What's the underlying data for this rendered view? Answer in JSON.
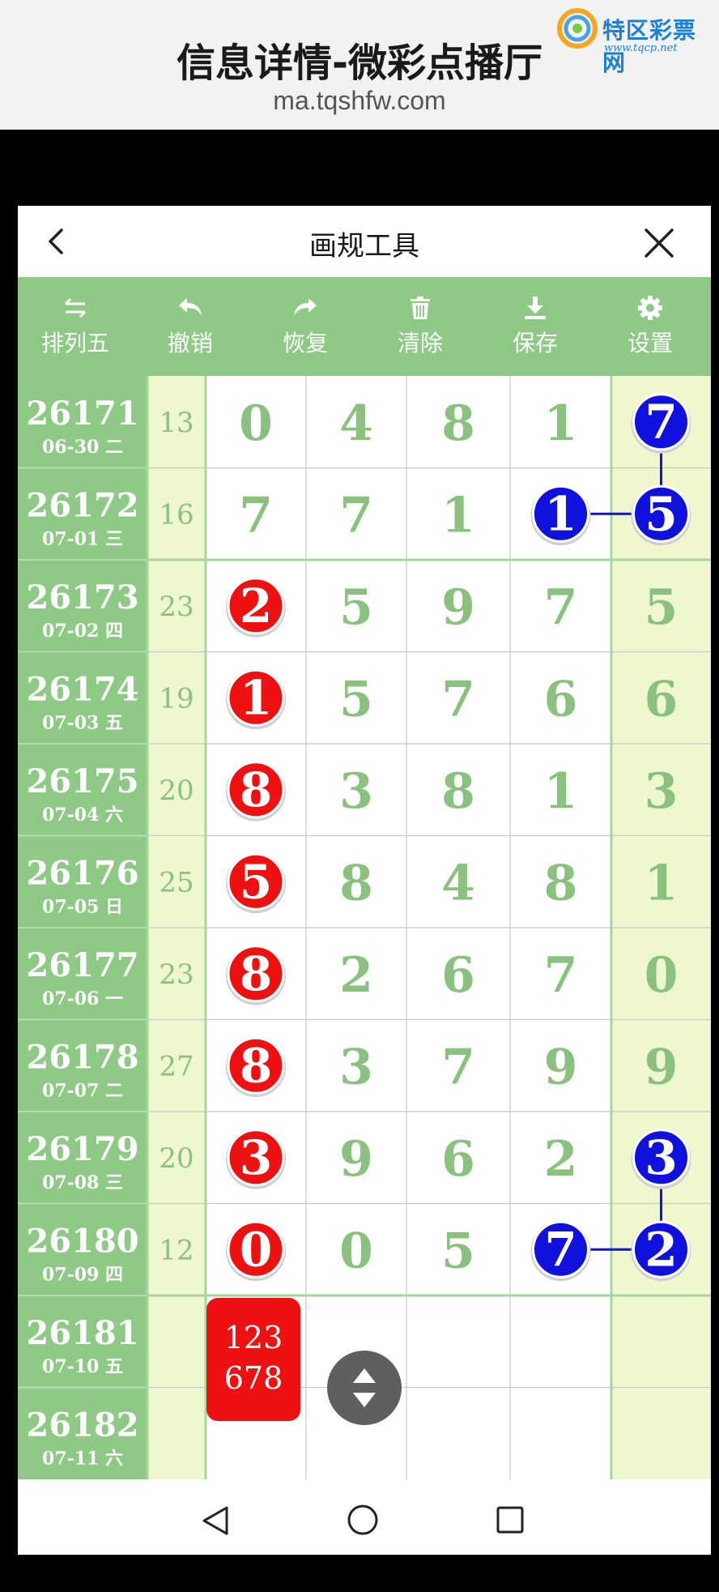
{
  "banner": {
    "title": "信息详情-微彩点播厅",
    "url": "ma.tqshfw.com",
    "logo_name": "特区彩票网",
    "logo_url": "www.tqcp.net"
  },
  "header": {
    "title": "画规工具"
  },
  "toolbar": [
    {
      "label": "排列五",
      "icon": "swap-icon"
    },
    {
      "label": "撤销",
      "icon": "undo-icon"
    },
    {
      "label": "恢复",
      "icon": "redo-icon"
    },
    {
      "label": "清除",
      "icon": "trash-icon"
    },
    {
      "label": "保存",
      "icon": "download-icon"
    },
    {
      "label": "设置",
      "icon": "gear-icon"
    }
  ],
  "rows": [
    {
      "issue": "26171",
      "date": "06-30 二",
      "sum": "13",
      "digits": [
        "0",
        "4",
        "8",
        "1",
        "7"
      ]
    },
    {
      "issue": "26172",
      "date": "07-01 三",
      "sum": "16",
      "digits": [
        "7",
        "7",
        "1",
        "1",
        "5"
      ]
    },
    {
      "issue": "26173",
      "date": "07-02 四",
      "sum": "23",
      "digits": [
        "2",
        "5",
        "9",
        "7",
        "5"
      ]
    },
    {
      "issue": "26174",
      "date": "07-03 五",
      "sum": "19",
      "digits": [
        "1",
        "5",
        "7",
        "6",
        "6"
      ]
    },
    {
      "issue": "26175",
      "date": "07-04 六",
      "sum": "20",
      "digits": [
        "8",
        "3",
        "8",
        "1",
        "3"
      ]
    },
    {
      "issue": "26176",
      "date": "07-05 日",
      "sum": "25",
      "digits": [
        "5",
        "8",
        "4",
        "8",
        "1"
      ]
    },
    {
      "issue": "26177",
      "date": "07-06 一",
      "sum": "23",
      "digits": [
        "8",
        "2",
        "6",
        "7",
        "0"
      ]
    },
    {
      "issue": "26178",
      "date": "07-07 二",
      "sum": "27",
      "digits": [
        "8",
        "3",
        "7",
        "9",
        "9"
      ]
    },
    {
      "issue": "26179",
      "date": "07-08 三",
      "sum": "20",
      "digits": [
        "3",
        "9",
        "6",
        "2",
        "3"
      ]
    },
    {
      "issue": "26180",
      "date": "07-09 四",
      "sum": "12",
      "digits": [
        "0",
        "0",
        "5",
        "7",
        "2"
      ]
    },
    {
      "issue": "26181",
      "date": "07-10 五",
      "sum": "",
      "digits": [
        "",
        "",
        "",
        "",
        ""
      ]
    },
    {
      "issue": "26182",
      "date": "07-11 六",
      "sum": "",
      "digits": [
        "",
        "",
        "",
        "",
        ""
      ]
    }
  ],
  "red_marks": [
    {
      "row": 2,
      "col": 0
    },
    {
      "row": 3,
      "col": 0
    },
    {
      "row": 4,
      "col": 0
    },
    {
      "row": 5,
      "col": 0
    },
    {
      "row": 6,
      "col": 0
    },
    {
      "row": 7,
      "col": 0
    },
    {
      "row": 8,
      "col": 0
    },
    {
      "row": 9,
      "col": 0
    }
  ],
  "blue_marks": [
    {
      "row": 0,
      "col": 4
    },
    {
      "row": 1,
      "col": 3
    },
    {
      "row": 1,
      "col": 4
    },
    {
      "row": 8,
      "col": 4
    },
    {
      "row": 9,
      "col": 3
    },
    {
      "row": 9,
      "col": 4
    }
  ],
  "links": [
    {
      "from": [
        0,
        4
      ],
      "to": [
        1,
        4
      ]
    },
    {
      "from": [
        1,
        3
      ],
      "to": [
        1,
        4
      ]
    },
    {
      "from": [
        8,
        4
      ],
      "to": [
        9,
        4
      ]
    },
    {
      "from": [
        9,
        3
      ],
      "to": [
        9,
        4
      ]
    }
  ],
  "prediction": {
    "line1": "123",
    "line2": "678"
  },
  "colors": {
    "green_dark": "#8ec985",
    "green_text": "#8ac17f",
    "light_col": "#eff7cf",
    "red": "#ee1111",
    "blue": "#1111dd"
  }
}
